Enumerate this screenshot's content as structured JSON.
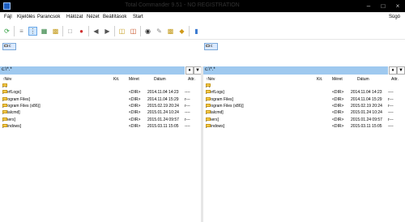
{
  "window": {
    "title": "Total Commander 9.51 - NO REGISTRATION"
  },
  "menu": {
    "items": [
      "Fájl",
      "Kijelölés",
      "Parancsok",
      "Hálózat",
      "Nézet",
      "Beállítások",
      "Start"
    ],
    "help": "Súgó"
  },
  "toolbar": {
    "icons": [
      "refresh-icon",
      "brief-view-icon",
      "detailed-view-icon",
      "tree-view-icon",
      "thumbnails-icon",
      "invert-selection-icon",
      "select-all-icon",
      "back-icon",
      "forward-icon",
      "pack-icon",
      "unpack-icon",
      "search-icon",
      "rename-icon",
      "sync-dirs-icon",
      "compare-icon",
      "notepad-icon"
    ]
  },
  "left": {
    "drive": "c",
    "path": "c:\\*.*",
    "columns": {
      "name": "Név",
      "ext": "Kit.",
      "size": "Méret",
      "date": "Dátum",
      "attr": "Attr."
    },
    "rows": [
      {
        "name": "[..]",
        "ext": "",
        "size": "",
        "date": "",
        "attr": ""
      },
      {
        "name": "[PerfLogs]",
        "ext": "",
        "size": "<DIR>",
        "date": "2014.11.04 14:23",
        "attr": "----"
      },
      {
        "name": "[Program Files]",
        "ext": "",
        "size": "<DIR>",
        "date": "2014.11.04 15:29",
        "attr": "r---"
      },
      {
        "name": "[Program Files (x86)]",
        "ext": "",
        "size": "<DIR>",
        "date": "2015.02.19 20:24",
        "attr": "r---"
      },
      {
        "name": "[totalcmd]",
        "ext": "",
        "size": "<DIR>",
        "date": "2015.01.24 10:24",
        "attr": "----"
      },
      {
        "name": "[Users]",
        "ext": "",
        "size": "<DIR>",
        "date": "2015.01.24 09:57",
        "attr": "r---"
      },
      {
        "name": "[Windows]",
        "ext": "",
        "size": "<DIR>",
        "date": "2015.03.11 15:05",
        "attr": "----"
      }
    ]
  },
  "right": {
    "drive": "c",
    "path": "c:\\*.*",
    "columns": {
      "name": "Név",
      "ext": "Kit.",
      "size": "Méret",
      "date": "Dátum",
      "attr": "Attr."
    },
    "rows": [
      {
        "name": "[..]",
        "ext": "",
        "size": "",
        "date": "",
        "attr": ""
      },
      {
        "name": "[PerfLogs]",
        "ext": "",
        "size": "<DIR>",
        "date": "2014.11.04 14:23",
        "attr": "----"
      },
      {
        "name": "[Program Files]",
        "ext": "",
        "size": "<DIR>",
        "date": "2014.11.04 15:29",
        "attr": "r---"
      },
      {
        "name": "[Program Files (x86)]",
        "ext": "",
        "size": "<DIR>",
        "date": "2015.02.19 20:24",
        "attr": "r---"
      },
      {
        "name": "[totalcmd]",
        "ext": "",
        "size": "<DIR>",
        "date": "2015.01.24 10:24",
        "attr": "----"
      },
      {
        "name": "[Users]",
        "ext": "",
        "size": "<DIR>",
        "date": "2015.01.24 09:57",
        "attr": "r---"
      },
      {
        "name": "[Windows]",
        "ext": "",
        "size": "<DIR>",
        "date": "2015.03.11 15:05",
        "attr": "----"
      }
    ]
  },
  "colors": {
    "path_bar": "#9fc9ef",
    "folder": "#f2c84b",
    "drive_button": "#dbeaff"
  }
}
